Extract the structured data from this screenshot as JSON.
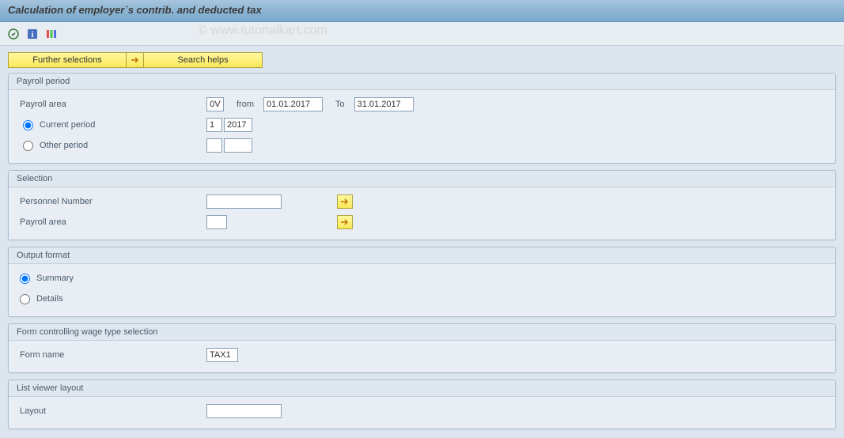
{
  "header": {
    "title": "Calculation of employer´s contrib. and deducted tax"
  },
  "watermark": "© www.tutorialkart.com",
  "buttons": {
    "further_selections": "Further selections",
    "search_helps": "Search helps"
  },
  "payroll_period": {
    "title": "Payroll period",
    "area_label": "Payroll area",
    "area_value": "0V",
    "from_label": "from",
    "from_value": "01.01.2017",
    "to_label": "To",
    "to_value": "31.01.2017",
    "current_label": "Current period",
    "current_num": "1",
    "current_year": "2017",
    "other_label": "Other period",
    "other_num": "",
    "other_year": ""
  },
  "selection": {
    "title": "Selection",
    "personnel_label": "Personnel Number",
    "personnel_value": "",
    "area_label": "Payroll area",
    "area_value": ""
  },
  "output_format": {
    "title": "Output format",
    "summary_label": "Summary",
    "details_label": "Details"
  },
  "form_control": {
    "title": "Form controlling wage type selection",
    "name_label": "Form name",
    "name_value": "TAX1"
  },
  "list_viewer": {
    "title": "List viewer layout",
    "layout_label": "Layout",
    "layout_value": ""
  }
}
